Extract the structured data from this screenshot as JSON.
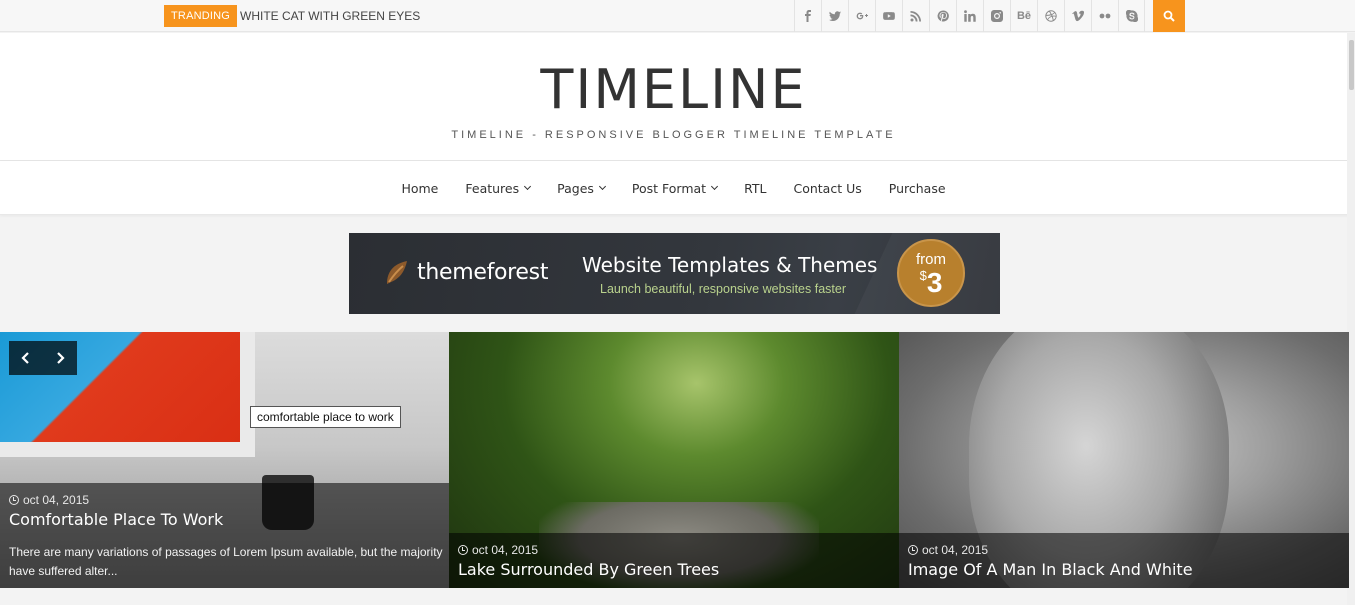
{
  "topbar": {
    "tranding_label": "TRANDING",
    "trending_text": "WHITE CAT WITH GREEN EYES",
    "socials": [
      {
        "icon": "facebook-icon",
        "glyph": "f"
      },
      {
        "icon": "twitter-icon",
        "glyph": "t"
      },
      {
        "icon": "google-plus-icon",
        "glyph": "g+"
      },
      {
        "icon": "youtube-icon",
        "glyph": "yt"
      },
      {
        "icon": "rss-icon",
        "glyph": "rss"
      },
      {
        "icon": "pinterest-icon",
        "glyph": "p"
      },
      {
        "icon": "linkedin-icon",
        "glyph": "in"
      },
      {
        "icon": "instagram-icon",
        "glyph": "ig"
      },
      {
        "icon": "behance-icon",
        "glyph": "Bē"
      },
      {
        "icon": "dribbble-icon",
        "glyph": "db"
      },
      {
        "icon": "vimeo-icon",
        "glyph": "v"
      },
      {
        "icon": "flickr-icon",
        "glyph": "fl"
      },
      {
        "icon": "skype-icon",
        "glyph": "s"
      }
    ],
    "search_icon": "search-icon"
  },
  "header": {
    "logo": "TIMELINE",
    "tagline": "TIMELINE - RESPONSIVE BLOGGER TIMELINE TEMPLATE"
  },
  "nav": {
    "items": [
      {
        "label": "Home",
        "dropdown": false
      },
      {
        "label": "Features",
        "dropdown": true
      },
      {
        "label": "Pages",
        "dropdown": true
      },
      {
        "label": "Post Format",
        "dropdown": true
      },
      {
        "label": "RTL",
        "dropdown": false
      },
      {
        "label": "Contact Us",
        "dropdown": false
      },
      {
        "label": "Purchase",
        "dropdown": false
      }
    ]
  },
  "banner": {
    "brand": "themeforest",
    "title": "Website Templates & Themes",
    "subtitle": "Launch beautiful, responsive websites faster",
    "from_label": "from",
    "price_currency": "$",
    "price_value": "3"
  },
  "slider": {
    "tooltip": "comfortable place to work",
    "slides": [
      {
        "date": "oct 04, 2015",
        "title": "Comfortable Place To Work",
        "excerpt": "There are many variations of passages of Lorem Ipsum available, but the majority have suffered alter..."
      },
      {
        "date": "oct 04, 2015",
        "title": "Lake Surrounded By Green Trees"
      },
      {
        "date": "oct 04, 2015",
        "title": "Image Of A Man In Black And White"
      }
    ]
  },
  "colors": {
    "accent": "#f7941d",
    "text_dark": "#333333",
    "banner_bg": "#33373d",
    "badge": "#b8802d"
  }
}
